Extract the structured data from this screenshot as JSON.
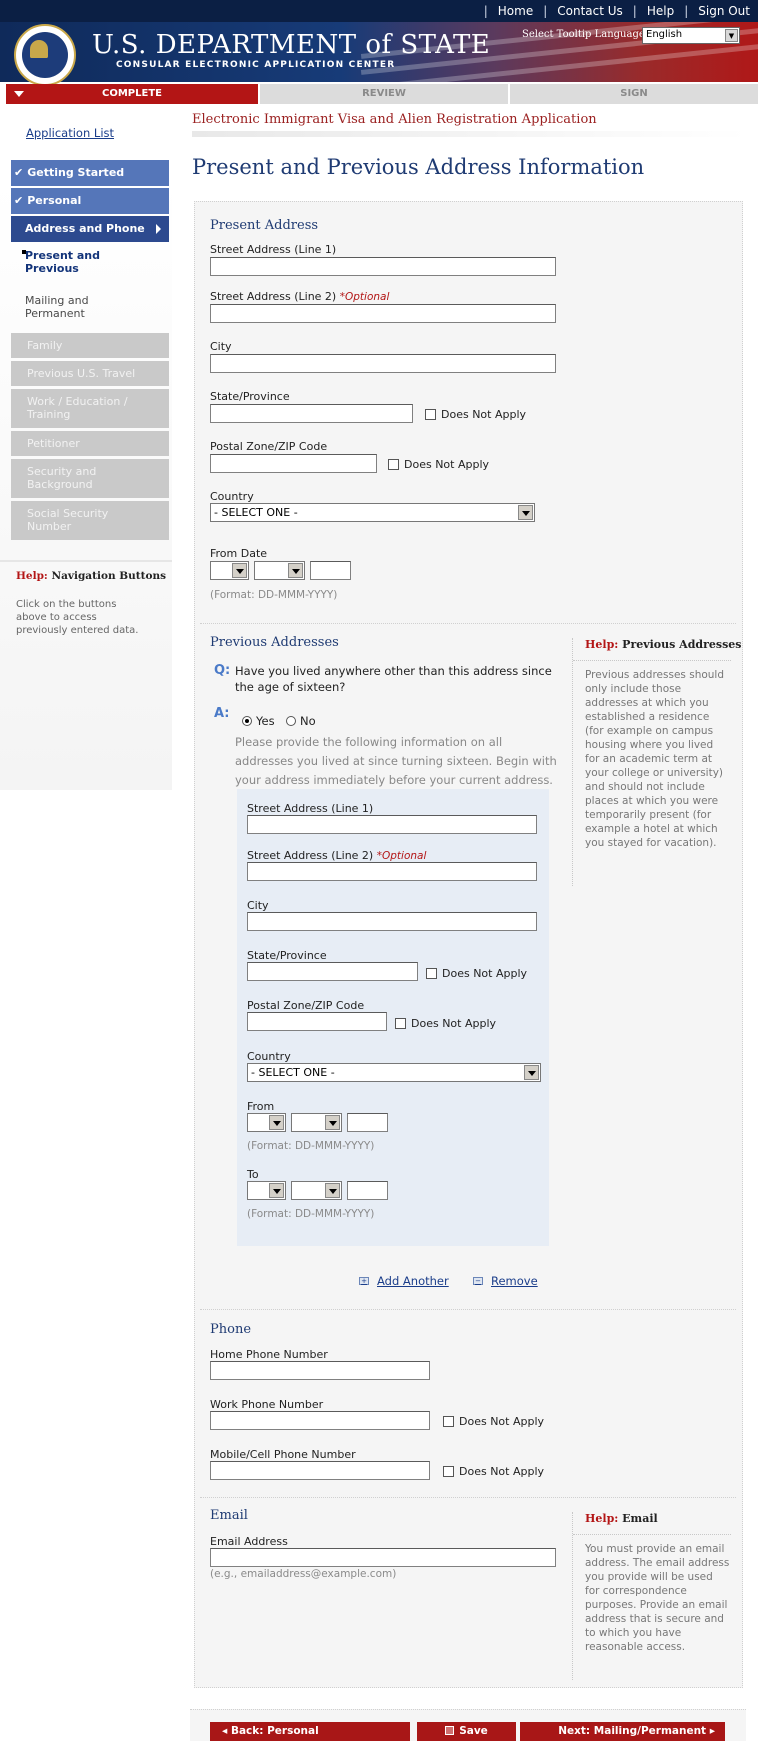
{
  "header": {
    "links": [
      "Home",
      "Contact Us",
      "Help",
      "Sign Out"
    ],
    "dept_name": "U.S. DEPARTMENT of STATE",
    "subtitle": "CONSULAR ELECTRONIC APPLICATION CENTER",
    "tooltip_label": "Select Tooltip Language:",
    "tooltip_value": "English"
  },
  "progress": {
    "tabs": [
      "COMPLETE",
      "REVIEW",
      "SIGN"
    ]
  },
  "sidebar": {
    "app_list": "Application List",
    "items": [
      {
        "label": "Getting Started",
        "state": "done"
      },
      {
        "label": "Personal",
        "state": "done"
      },
      {
        "label": "Address and Phone",
        "state": "current"
      },
      {
        "label": "Present and\nPrevious",
        "state": "sub-active"
      },
      {
        "label": "Mailing and\nPermanent",
        "state": "sub"
      },
      {
        "label": "Family",
        "state": "locked"
      },
      {
        "label": "Previous U.S. Travel",
        "state": "locked"
      },
      {
        "label": "Work / Education /\nTraining",
        "state": "locked"
      },
      {
        "label": "Petitioner",
        "state": "locked"
      },
      {
        "label": "Security and\nBackground",
        "state": "locked"
      },
      {
        "label": "Social Security\nNumber",
        "state": "locked"
      }
    ],
    "help_prefix": "Help:",
    "help_title": "Navigation Buttons",
    "help_text": "Click on the buttons above to access previously entered data."
  },
  "main": {
    "app_title": "Electronic Immigrant Visa and Alien Registration Application",
    "page_title": "Present and Previous Address Information"
  },
  "present": {
    "heading": "Present Address",
    "street1": "Street Address (Line 1)",
    "street2": "Street Address (Line 2)",
    "optional": "*Optional",
    "city": "City",
    "state": "State/Province",
    "postal": "Postal Zone/ZIP Code",
    "does_not_apply": "Does Not Apply",
    "country": "Country",
    "country_value": "- SELECT ONE -",
    "from_date": "From Date",
    "format": "(Format: DD-MMM-YYYY)"
  },
  "previous": {
    "heading": "Previous Addresses",
    "q": "Q:",
    "question": "Have you lived anywhere other than this address since the age of sixteen?",
    "a": "A:",
    "yes": "Yes",
    "no": "No",
    "answer": "Yes",
    "instructions": "Please provide the following information on all addresses you lived at since turning sixteen. Begin with your address immediately before your current address.",
    "street1": "Street Address (Line 1)",
    "street2": "Street Address (Line 2)",
    "optional": "*Optional",
    "city": "City",
    "state": "State/Province",
    "postal": "Postal Zone/ZIP Code",
    "does_not_apply": "Does Not Apply",
    "country": "Country",
    "country_value": "- SELECT ONE -",
    "from": "From",
    "to": "To",
    "format": "(Format: DD-MMM-YYYY)",
    "add_another": "Add Another",
    "remove": "Remove",
    "help_prefix": "Help:",
    "help_title": "Previous Addresses",
    "help_text": "Previous addresses should only include those addresses at which you established a residence (for example on campus housing where you lived for an academic term at your college or university) and should not include places at which you were temporarily present (for example a hotel at which you stayed for vacation)."
  },
  "phone": {
    "heading": "Phone",
    "home": "Home Phone Number",
    "work": "Work Phone Number",
    "mobile": "Mobile/Cell Phone Number",
    "does_not_apply": "Does Not Apply"
  },
  "email": {
    "heading": "Email",
    "label": "Email Address",
    "example": "(e.g., emailaddress@example.com)",
    "help_prefix": "Help:",
    "help_title": "Email",
    "help_text": "You must provide an email address. The email address you provide will be used for correspondence purposes. Provide an email address that is secure and to which you have reasonable access."
  },
  "nav": {
    "back": "Back: Personal",
    "save": "Save",
    "next": "Next: Mailing/Permanent"
  }
}
